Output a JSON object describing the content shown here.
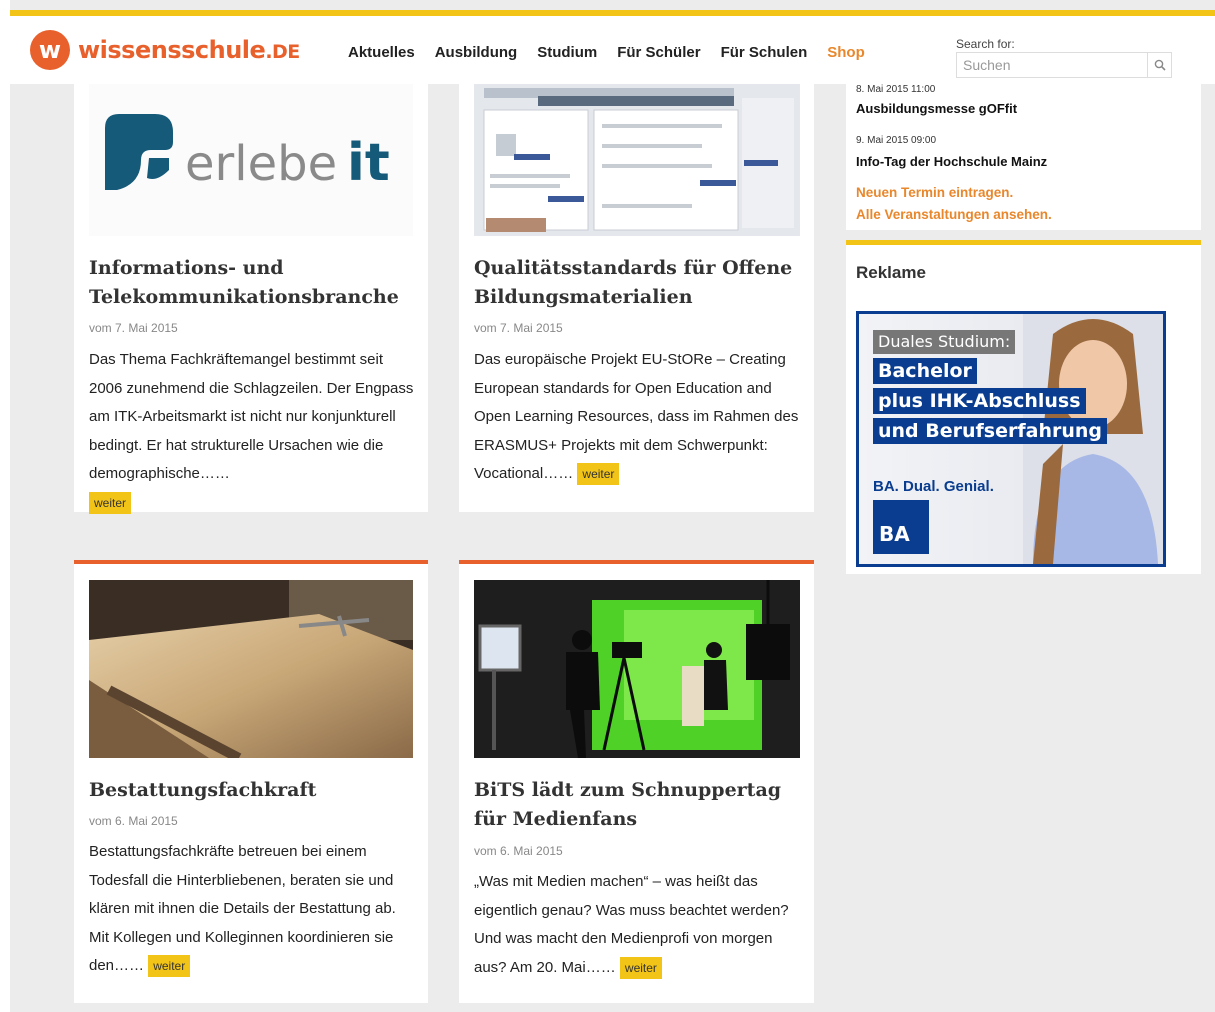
{
  "site": {
    "logo_letter": "w",
    "logo_name": "wissensschule",
    "logo_tld": ".DE"
  },
  "nav": {
    "items": [
      "Aktuelles",
      "Ausbildung",
      "Studium",
      "Für Schüler",
      "Für Schulen",
      "Shop"
    ]
  },
  "search": {
    "label": "Search for:",
    "placeholder": "Suchen"
  },
  "articles": [
    {
      "title": "Informations- und Telekommunikationsbranche",
      "date": "vom 7. Mai 2015",
      "text": "Das Thema Fachkräftemangel bestimmt seit 2006 zunehmend die Schlagzeilen. Der Engpass am ITK-Arbeitsmarkt ist nicht nur konjunkturell bedingt. Er hat strukturelle Ursachen wie die demographische……",
      "image_logo_a": "erlebe",
      "image_logo_b": "it"
    },
    {
      "title": "Qualitätsstandards für Offene Bildungsmaterialien",
      "date": "vom 7. Mai 2015",
      "text": "Das europäische Projekt EU-StORe – Creating European standards for Open Education and Open Learning Resources, dass im Rahmen des ERASMUS+ Projekts mit dem Schwerpunkt: Vocational……"
    },
    {
      "title": "Bestattungsfachkraft",
      "date": "vom 6. Mai 2015",
      "text": "Bestattungsfachkräfte betreuen bei einem Todesfall die Hinterbliebenen, beraten sie und klären mit ihnen die Details der Bestattung ab. Mit Kollegen und Kolleginnen koordinieren sie den……"
    },
    {
      "title": "BiTS lädt zum Schnuppertag für Medienfans",
      "date": "vom 6. Mai 2015",
      "text": "„Was mit Medien machen“ – was heißt das eigentlich genau? Was muss beachtet werden? Und was macht den Medienprofi von morgen aus? Am 20. Mai……"
    }
  ],
  "weiter_label": "weiter",
  "events": {
    "items": [
      {
        "date": "8. Mai 2015 11:00",
        "title": "Ausbildungsmesse gOFfit"
      },
      {
        "date": "9. Mai 2015 09:00",
        "title": "Info-Tag der Hochschule Mainz"
      }
    ],
    "new_link": "Neuen Termin eintragen.",
    "all_link": "Alle Veranstaltungen ansehen."
  },
  "ad": {
    "heading": "Reklame",
    "line1": "Duales Studium:",
    "line2": "Bachelor",
    "line3": "plus IHK-Abschluss",
    "line4": "und Berufserfahrung",
    "tagline": "BA. Dual. Genial.",
    "brand": "BA"
  },
  "colors": {
    "accent_orange": "#e8602c",
    "accent_yellow": "#f2c417",
    "ad_blue": "#0a3d8f"
  }
}
